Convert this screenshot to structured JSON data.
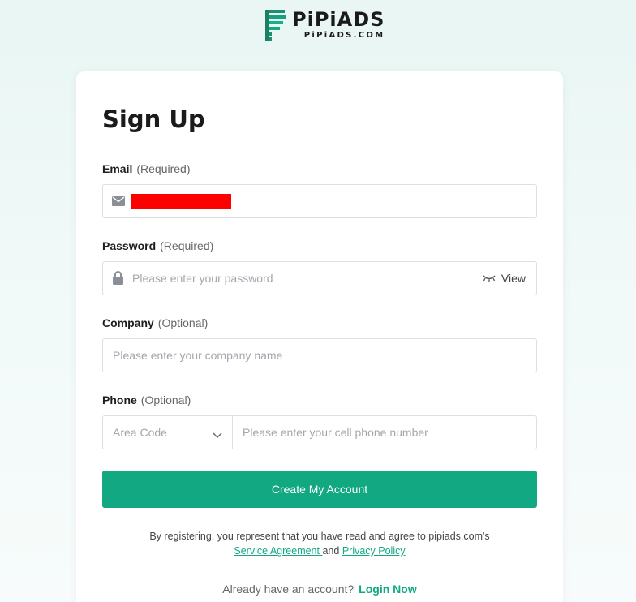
{
  "brand": {
    "name": "PiPiADS",
    "domain": "PiPiADS.COM",
    "accent": "#12a882"
  },
  "form": {
    "title": "Sign Up",
    "email": {
      "label": "Email",
      "qualifier": "(Required)",
      "icon": "mail-icon",
      "value_redacted": true
    },
    "password": {
      "label": "Password",
      "qualifier": "(Required)",
      "placeholder": "Please enter your password",
      "view_label": "View",
      "icon": "lock-icon"
    },
    "company": {
      "label": "Company",
      "qualifier": "(Optional)",
      "placeholder": "Please enter your company name"
    },
    "phone": {
      "label": "Phone",
      "qualifier": "(Optional)",
      "area_code_placeholder": "Area Code",
      "placeholder": "Please enter your cell phone number"
    },
    "submit_label": "Create My Account",
    "terms_text": "By registering, you represent that you have read and agree to pipiads.com's",
    "service_agreement": "Service Agreement ",
    "and": " and ",
    "privacy_policy": "Privacy Policy",
    "already_text": "Already have an account?",
    "login_label": "Login Now"
  }
}
